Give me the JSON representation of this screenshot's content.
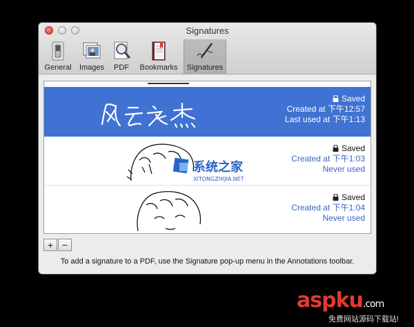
{
  "window": {
    "title": "Signatures"
  },
  "toolbar": {
    "items": [
      {
        "label": "General",
        "icon": "switch-icon"
      },
      {
        "label": "Images",
        "icon": "photos-icon"
      },
      {
        "label": "PDF",
        "icon": "magnifier-icon"
      },
      {
        "label": "Bookmarks",
        "icon": "bookmark-book-icon"
      },
      {
        "label": "Signatures",
        "icon": "pen-signature-icon",
        "selected": true
      }
    ]
  },
  "signatures": [
    {
      "status": "Saved",
      "created": "Created at 下午12:57",
      "used": "Last used at 下午1:13",
      "selected": true
    },
    {
      "status": "Saved",
      "created": "Created at 下午1:03",
      "used": "Never used",
      "selected": false
    },
    {
      "status": "Saved",
      "created": "Created at 下午1:04",
      "used": "Never used",
      "selected": false
    }
  ],
  "buttons": {
    "add": "+",
    "remove": "−"
  },
  "hint": "To add a signature to a PDF, use the Signature pop-up menu in the Annotations toolbar.",
  "watermarks": {
    "xitong_name": "系统之家",
    "xitong_url": "XITONGZHIJIA.NET",
    "aspku_logo": "aspku",
    "aspku_dot": ".com",
    "aspku_sub": "免费网站源码下载站!"
  },
  "colors": {
    "selection": "#3f72d3",
    "link": "#3a62c5",
    "aspku_a": "#e03a2e"
  }
}
